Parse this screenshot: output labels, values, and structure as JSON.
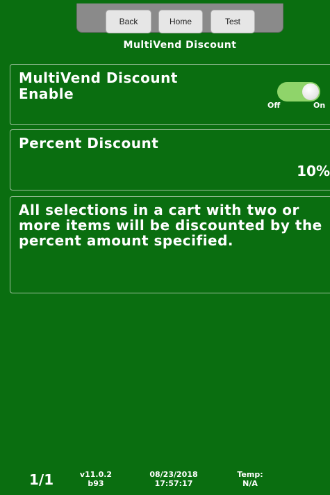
{
  "nav": {
    "back_label": "Back",
    "home_label": "Home",
    "test_label": "Test"
  },
  "screen": {
    "title": "MultiVend Discount"
  },
  "settings": {
    "enable": {
      "title_line1": "MultiVend Discount",
      "title_line2": "Enable",
      "toggle_off_label": "Off",
      "toggle_on_label": "On",
      "state": "on"
    },
    "percent": {
      "title": "Percent Discount",
      "value": "10%"
    },
    "description": "All selections in a cart with two or more items will be discounted by the percent amount specified."
  },
  "footer": {
    "page": "1/1",
    "version": "v11.0.2",
    "build": "b93",
    "date": "08/23/2018",
    "time": "17:57:17",
    "temp_label": "Temp:",
    "temp_value": "N/A"
  },
  "colors": {
    "background": "#0a6e10",
    "toggle_on": "#8fd46a",
    "panel_border": "#9fc29f",
    "nav_bar": "#8a8a8a"
  }
}
